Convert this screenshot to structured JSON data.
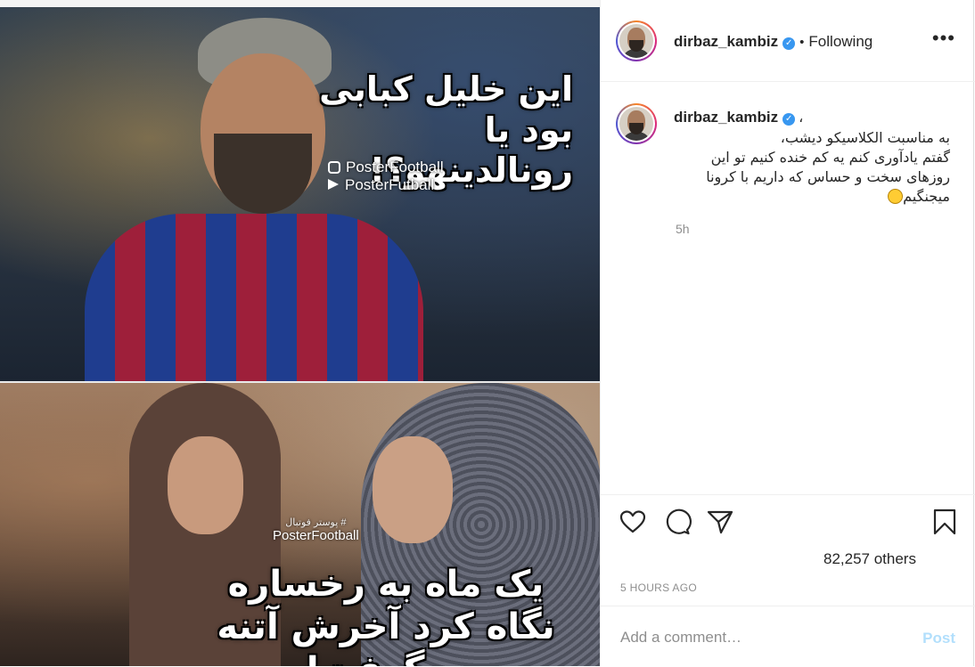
{
  "post": {
    "image": {
      "caption_top": "این خلیل کبابی بود یا رونالدینهو؟!",
      "handle_instagram": "PosterFootball",
      "handle_telegram": "PosterFutball",
      "watermark_fa": "# پوستر فوتبال",
      "watermark_en": "PosterFootball",
      "caption_bottom": "یک ماه به رخساره نگاه کرد آخرش آتنه روگرفت!"
    },
    "header": {
      "username": "dirbaz_kambiz",
      "separator": "•",
      "follow_status": "Following",
      "more_label": "•••"
    },
    "caption": {
      "username": "dirbaz_kambiz",
      "after_name": "،",
      "line1": "به مناسبت الکلاسیکو دیشب،",
      "line2": "گفتم یادآوری کنم یه کم خنده کنیم تو این",
      "line3": "روزهای سخت و حساس که داریم با کرونا",
      "line4": "میجنگیم",
      "age": "5h"
    },
    "actions": {
      "likes_text": "82,257 others",
      "posted": "5 HOURS AGO"
    },
    "add_comment": {
      "placeholder": "Add a comment…",
      "post_label": "Post"
    },
    "icons": [
      "heart-icon",
      "comment-icon",
      "share-icon",
      "bookmark-icon",
      "verified-icon",
      "more-icon"
    ],
    "colors": {
      "verified": "#3897f0",
      "post_button_disabled": "#b2dffc",
      "muted": "#8e8e8e"
    }
  }
}
